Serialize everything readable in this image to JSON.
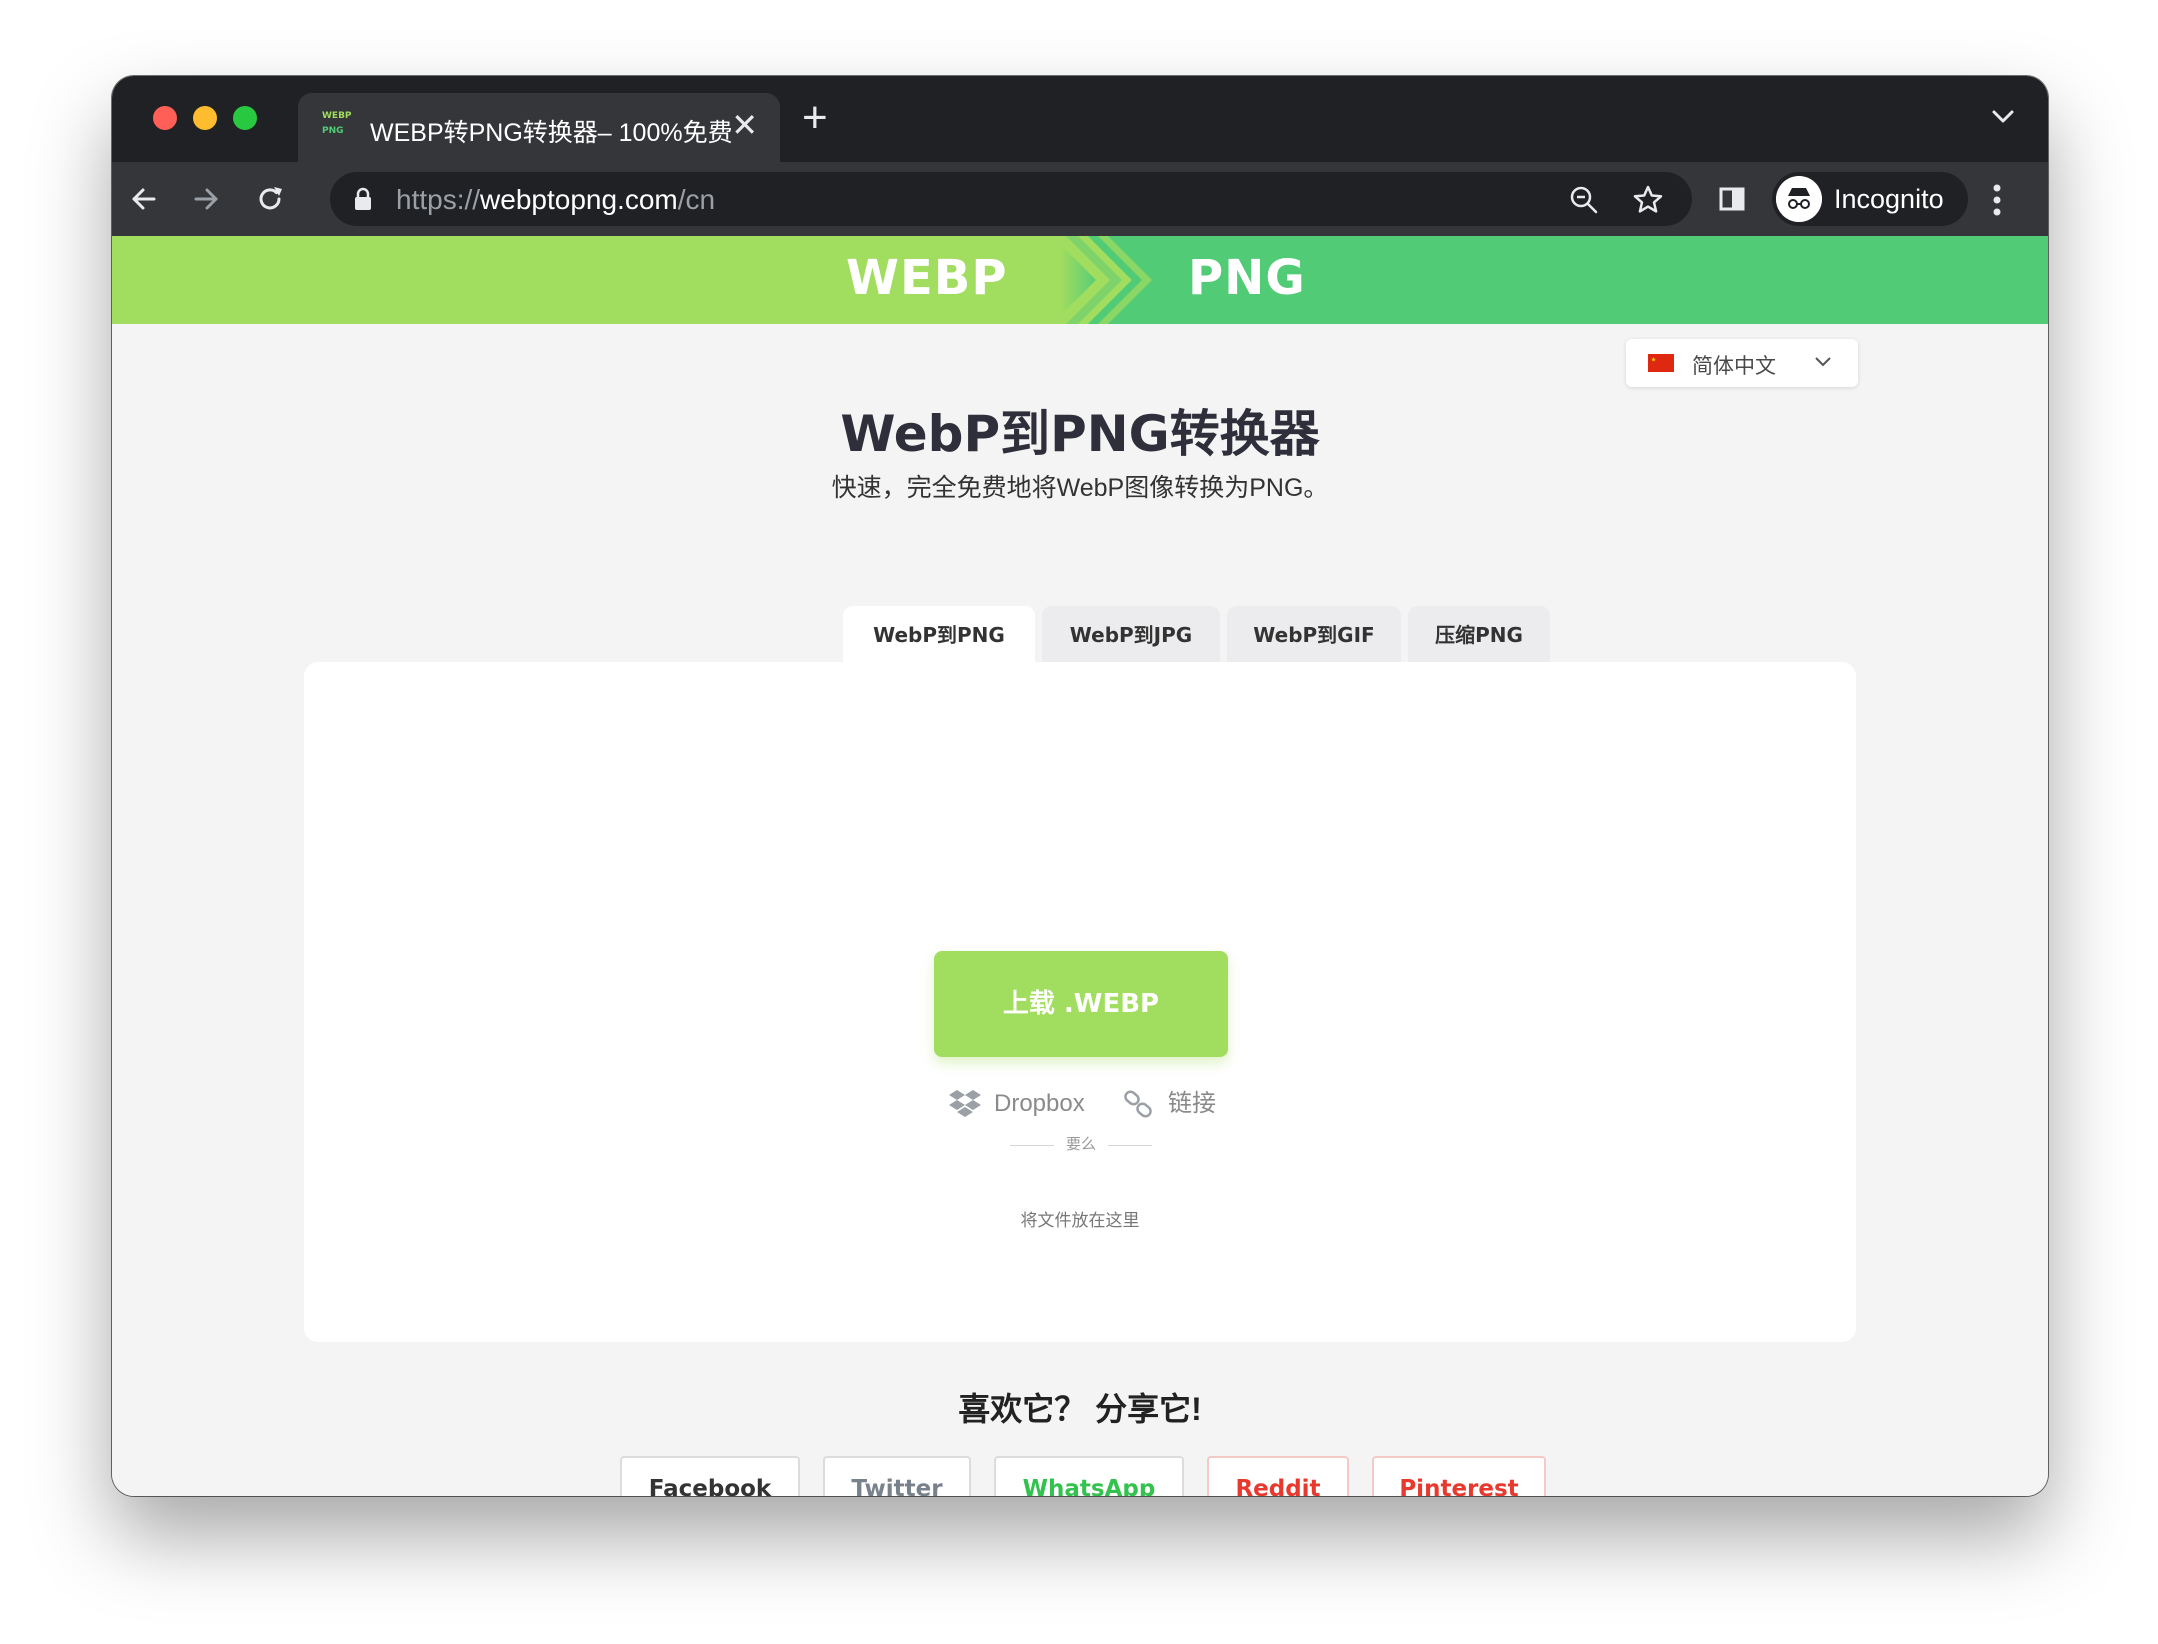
{
  "browser": {
    "tab_title": "WEBP转PNG转换器– 100%免费",
    "tab_favicon": {
      "line1": "WEBP",
      "line2": "PNG"
    },
    "tab_close": "✕",
    "new_tab": "+",
    "url_scheme": "https://",
    "url_host": "webptopng.com",
    "url_path": "/cn",
    "profile_label": "Incognito",
    "icons": [
      "back-icon",
      "forward-icon",
      "reload-icon",
      "lock-icon",
      "zoom-icon",
      "star-icon",
      "side-panel-icon",
      "incognito-icon",
      "menu-icon",
      "tab-search-icon"
    ]
  },
  "banner": {
    "left": "WEBP",
    "right": "PNG"
  },
  "language": {
    "selected": "简体中文",
    "flag": "china-flag-icon"
  },
  "hero": {
    "title": "WebP到PNG转换器",
    "subtitle": "快速，完全免费地将WebP图像转换为PNG。"
  },
  "tabs": [
    {
      "label": "WebP到PNG",
      "active": true
    },
    {
      "label": "WebP到JPG",
      "active": false
    },
    {
      "label": "WebP到GIF",
      "active": false
    },
    {
      "label": "压缩PNG",
      "active": false
    }
  ],
  "upload": {
    "button_label": "上载 .WEBP",
    "dropbox_label": "Dropbox",
    "link_label": "链接",
    "or_label": "要么",
    "drop_hint": "将文件放在这里"
  },
  "share": {
    "title": "喜欢它？ 分享它!",
    "buttons": [
      {
        "label": "Facebook",
        "color": "#333333"
      },
      {
        "label": "Twitter",
        "color": "#78828c"
      },
      {
        "label": "WhatsApp",
        "color": "#33c24d"
      },
      {
        "label": "Reddit",
        "color": "#e9382d"
      },
      {
        "label": "Pinterest",
        "color": "#e9382d"
      }
    ]
  },
  "colors": {
    "light_green": "#a1dd5f",
    "green": "#52cb77",
    "chrome_dark": "#202124",
    "chrome_toolbar": "#35363a"
  }
}
